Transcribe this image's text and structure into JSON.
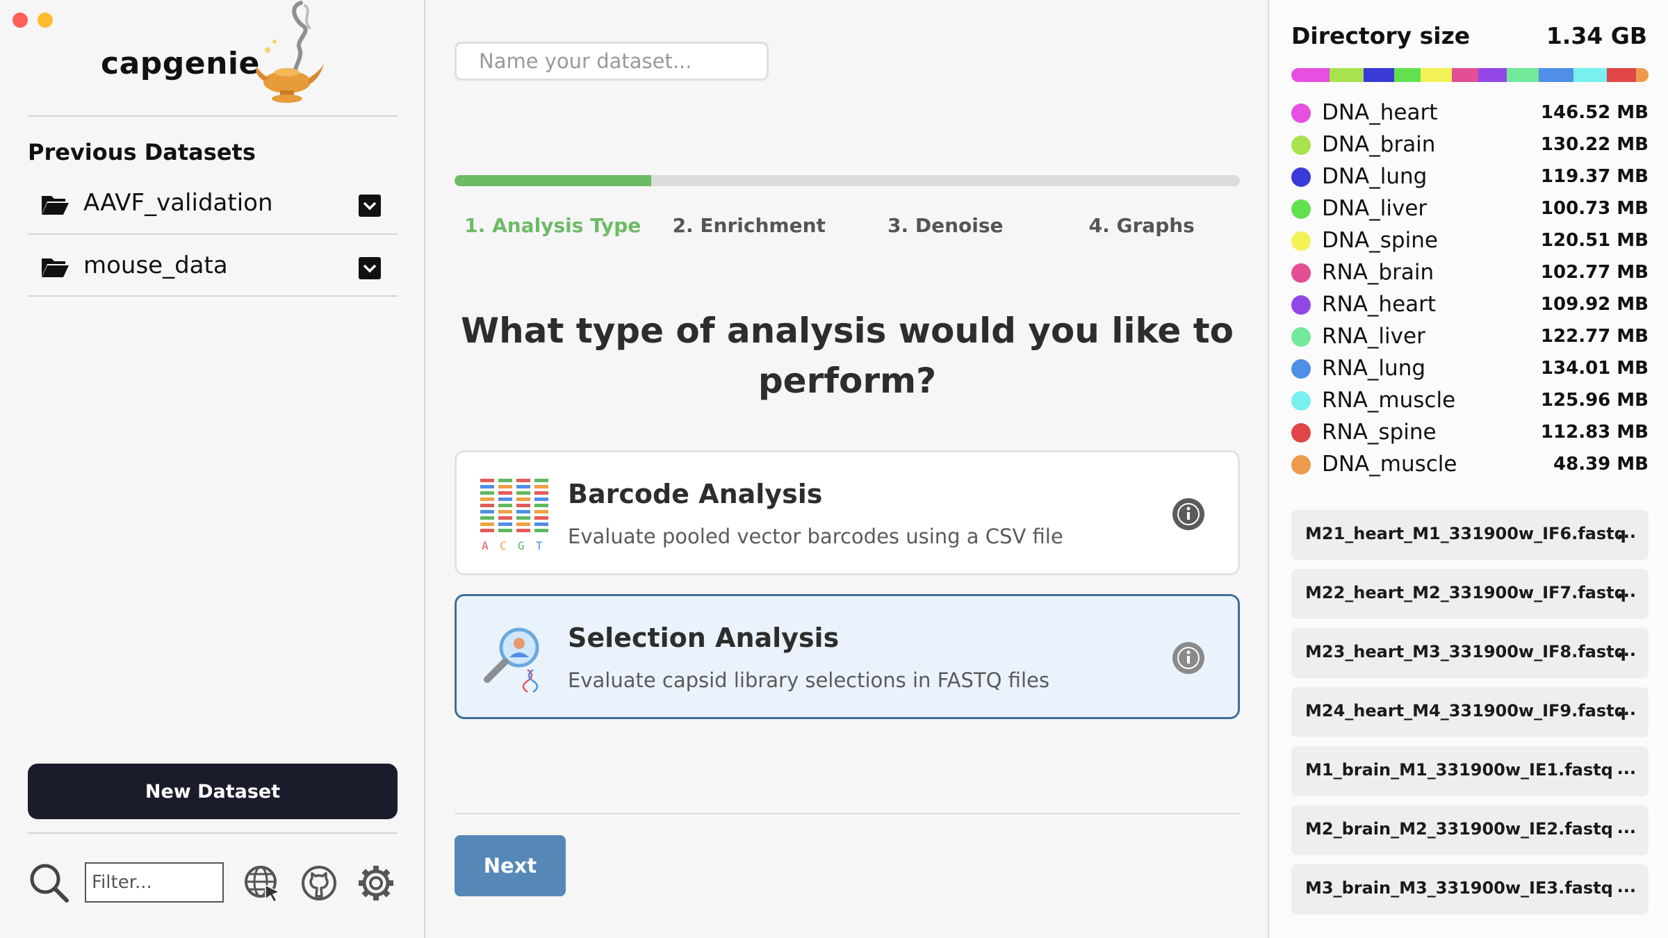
{
  "app": {
    "name": "capgenie"
  },
  "sidebar": {
    "previous_title": "Previous Datasets",
    "datasets": [
      {
        "label": "AAVF_validation"
      },
      {
        "label": "mouse_data"
      }
    ],
    "new_dataset_label": "New Dataset",
    "filter_placeholder": "Filter...",
    "icons": [
      "search-icon",
      "globe-cursor-icon",
      "github-icon",
      "gear-icon"
    ]
  },
  "main": {
    "name_placeholder": "Name your dataset...",
    "progress_fraction": 0.25,
    "steps": [
      {
        "label": "1. Analysis Type",
        "active": true
      },
      {
        "label": "2. Enrichment",
        "active": false
      },
      {
        "label": "3. Denoise",
        "active": false
      },
      {
        "label": "4. Graphs",
        "active": false
      }
    ],
    "question": "What type of analysis would you like to perform?",
    "options": [
      {
        "title": "Barcode Analysis",
        "description": "Evaluate pooled vector barcodes using a CSV file",
        "icon": "barcode-sequence-icon",
        "selected": false
      },
      {
        "title": "Selection Analysis",
        "description": "Evaluate capsid library selections in FASTQ files",
        "icon": "magnifier-dna-icon",
        "selected": true
      }
    ],
    "next_label": "Next",
    "accent_color": "#6dbb65",
    "next_color": "#5588b7"
  },
  "directory": {
    "title": "Directory size",
    "total": "1.34 GB",
    "items": [
      {
        "name": "DNA_heart",
        "size": "146.52 MB",
        "mb": 146.52,
        "color": "#e64fe0"
      },
      {
        "name": "DNA_brain",
        "size": "130.22 MB",
        "mb": 130.22,
        "color": "#a8e34e"
      },
      {
        "name": "DNA_lung",
        "size": "119.37 MB",
        "mb": 119.37,
        "color": "#3a3ad8"
      },
      {
        "name": "DNA_liver",
        "size": "100.73 MB",
        "mb": 100.73,
        "color": "#62e04f"
      },
      {
        "name": "DNA_spine",
        "size": "120.51 MB",
        "mb": 120.51,
        "color": "#f3f255"
      },
      {
        "name": "RNA_brain",
        "size": "102.77 MB",
        "mb": 102.77,
        "color": "#e24f95"
      },
      {
        "name": "RNA_heart",
        "size": "109.92 MB",
        "mb": 109.92,
        "color": "#9347e6"
      },
      {
        "name": "RNA_liver",
        "size": "122.77 MB",
        "mb": 122.77,
        "color": "#72e89a"
      },
      {
        "name": "RNA_lung",
        "size": "134.01 MB",
        "mb": 134.01,
        "color": "#4f8fe6"
      },
      {
        "name": "RNA_muscle",
        "size": "125.96 MB",
        "mb": 125.96,
        "color": "#78f0f0"
      },
      {
        "name": "RNA_spine",
        "size": "112.83 MB",
        "mb": 112.83,
        "color": "#e04646"
      },
      {
        "name": "DNA_muscle",
        "size": "48.39 MB",
        "mb": 48.39,
        "color": "#ec9a4b"
      }
    ],
    "files": [
      "M21_heart_M1_331900w_IF6.fastq",
      "M22_heart_M2_331900w_IF7.fastq",
      "M23_heart_M3_331900w_IF8.fastq",
      "M24_heart_M4_331900w_IF9.fastq",
      "M1_brain_M1_331900w_IE1.fastq",
      "M2_brain_M2_331900w_IE2.fastq",
      "M3_brain_M3_331900w_IE3.fastq"
    ],
    "file_more_label": "..."
  }
}
